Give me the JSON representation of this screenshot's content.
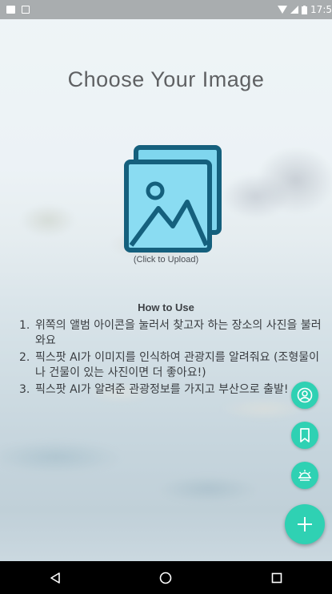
{
  "status_bar": {
    "time": "17:5"
  },
  "main": {
    "title": "Choose Your Image",
    "upload_caption": "(Click to Upload)",
    "how_to_title": "How to Use",
    "steps": [
      {
        "num": "1.",
        "text": "위쪽의 앨범 아이콘을 눌러서 찾고자 하는 장소의 사진을 불러와요"
      },
      {
        "num": "2.",
        "text": "픽스팟 AI가 이미지를 인식하여 관광지를 알려줘요 (조형물이나 건물이 있는 사진이면 더 좋아요!)"
      },
      {
        "num": "3.",
        "text": "픽스팟 AI가 알려준 관광정보를 가지고 부산으로 출발!"
      }
    ]
  },
  "fabs": {
    "items": [
      {
        "icon": "person-icon"
      },
      {
        "icon": "bookmark-icon"
      },
      {
        "icon": "sunrise-icon"
      },
      {
        "icon": "plus-icon"
      }
    ],
    "color": "#2fd1b3"
  },
  "nav": {
    "items": [
      "back",
      "home",
      "recents"
    ]
  },
  "colors": {
    "accent": "#2fd1b3",
    "image_icon_fill": "#7fd6ee",
    "image_icon_stroke": "#15607d"
  }
}
